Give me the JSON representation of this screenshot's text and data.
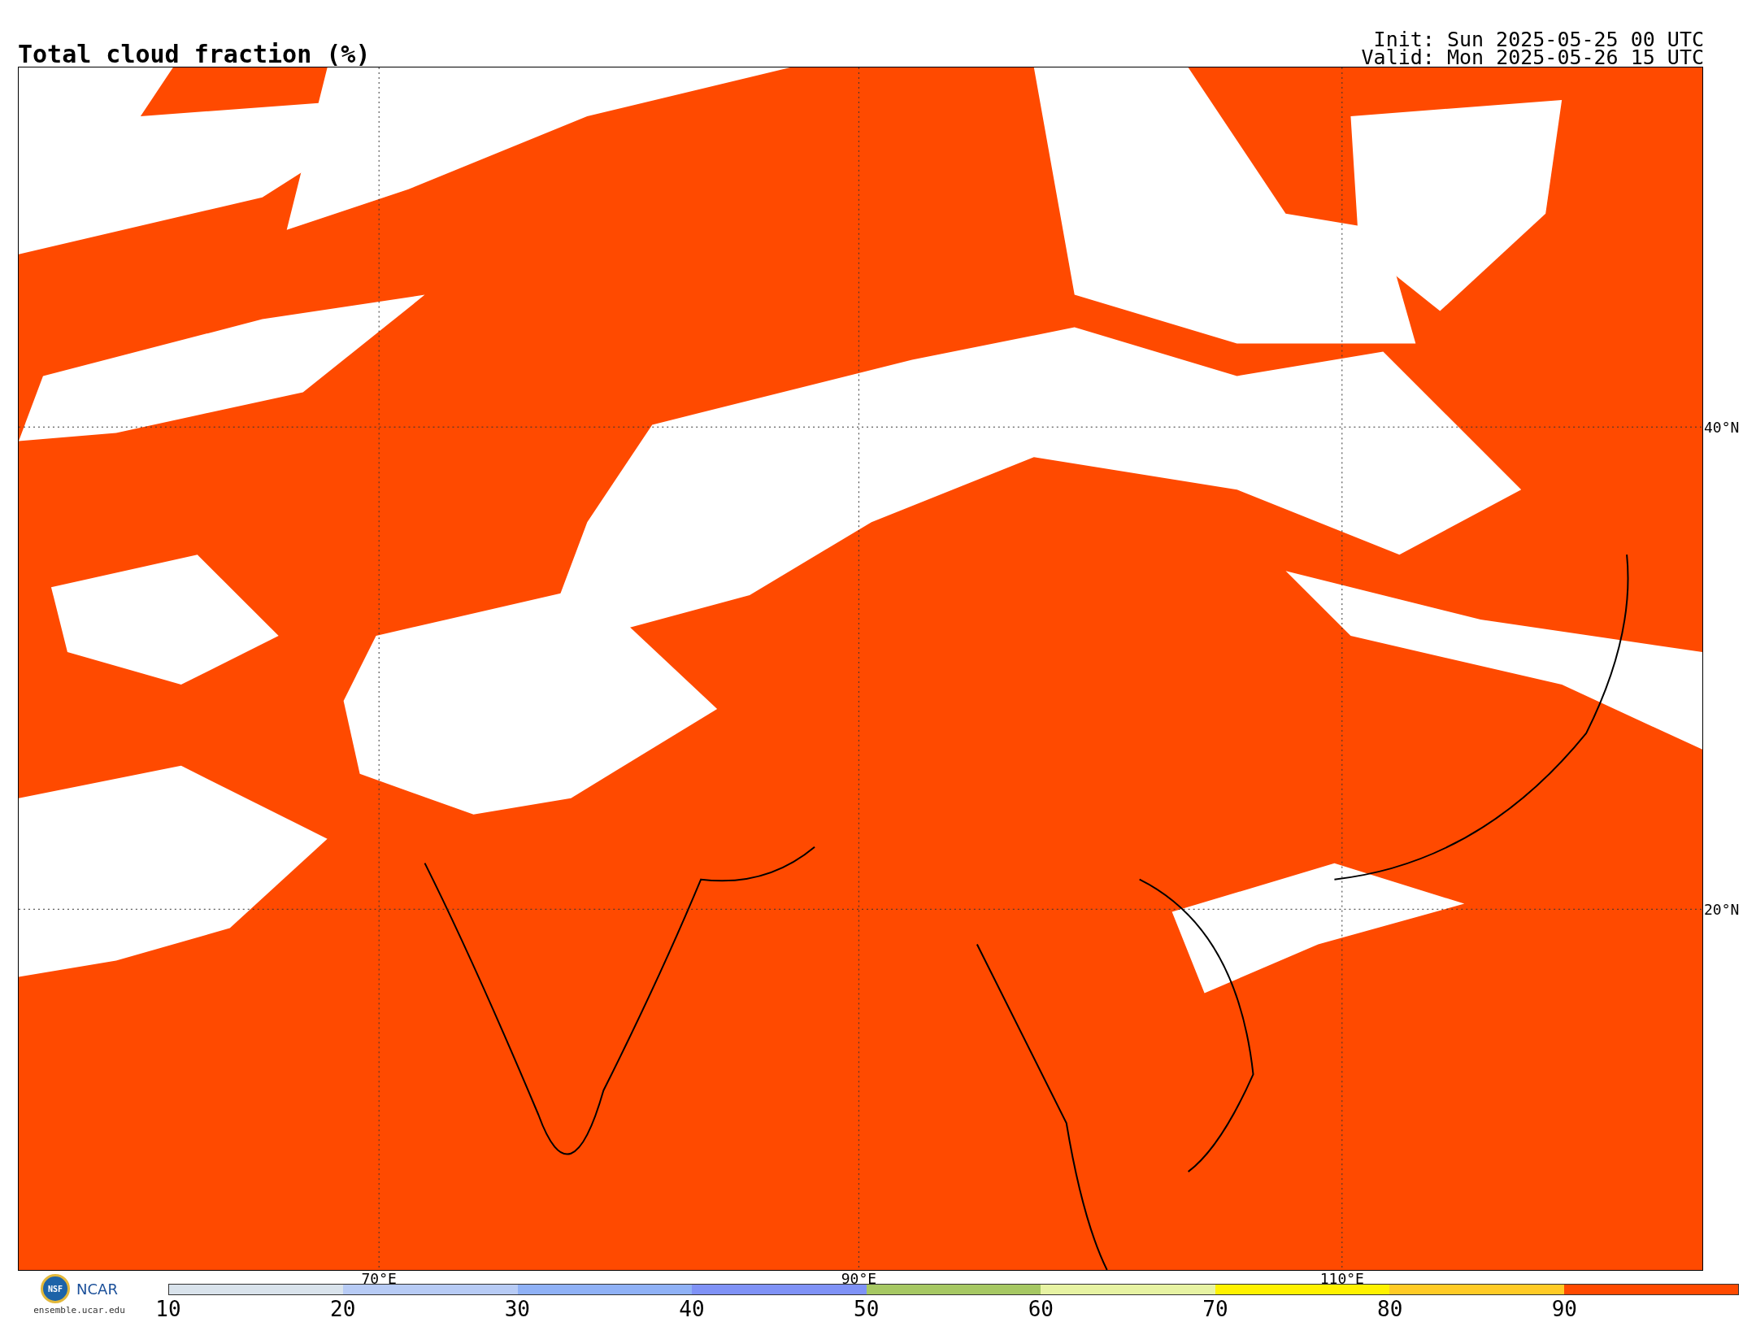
{
  "title": "Total cloud fraction (%)",
  "init": "Init: Sun 2025-05-25 00 UTC",
  "valid": "Valid: Mon 2025-05-26 15 UTC",
  "map": {
    "lat_labels": [
      "40°N",
      "20°N"
    ],
    "lon_labels": [
      "70°E",
      "90°E",
      "110°E"
    ]
  },
  "logo": {
    "seal": "NSF",
    "name": "NCAR",
    "url": "ensemble.ucar.edu"
  },
  "colorbar": {
    "ticks": [
      "10",
      "20",
      "30",
      "40",
      "50",
      "60",
      "70",
      "80",
      "90"
    ],
    "segments": [
      {
        "color": "#d9e3ec"
      },
      {
        "color": "#b7cbf5"
      },
      {
        "color": "#8fb1f6"
      },
      {
        "color": "#7f92f6"
      },
      {
        "color": "#a6c863"
      },
      {
        "color": "#e7f3a3"
      },
      {
        "color": "#fff200"
      },
      {
        "color": "#ffcb26"
      },
      {
        "color": "#ff4a00"
      }
    ]
  }
}
